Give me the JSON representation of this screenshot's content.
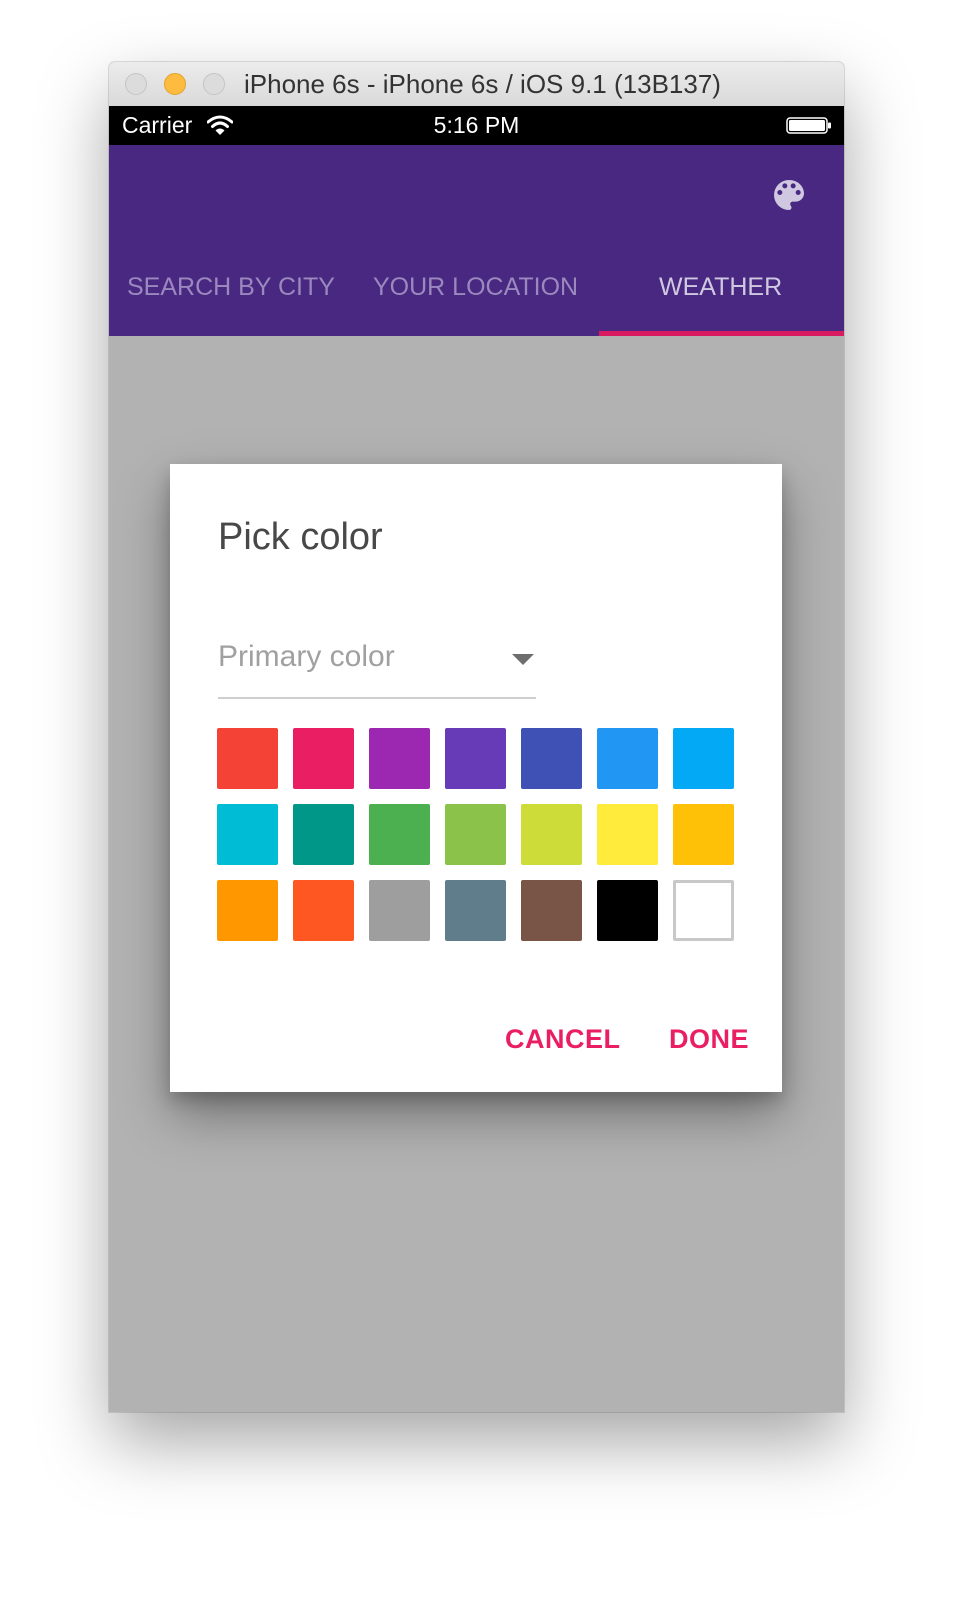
{
  "window": {
    "title": "iPhone 6s - iPhone 6s / iOS 9.1 (13B137)"
  },
  "status_bar": {
    "carrier": "Carrier",
    "time": "5:16 PM",
    "icons": [
      "wifi-icon",
      "battery-icon"
    ]
  },
  "app_bar": {
    "background": "#482880",
    "action_icon": "palette-icon",
    "tabs": [
      {
        "label": "SEARCH BY CITY",
        "selected": false
      },
      {
        "label": "YOUR LOCATION",
        "selected": false
      },
      {
        "label": "WEATHER",
        "selected": true
      }
    ],
    "indicator_color": "#d81b60"
  },
  "dialog": {
    "title": "Pick color",
    "select_value": "Primary color",
    "swatches": [
      "#f44336",
      "#e91e63",
      "#9c27b0",
      "#673ab7",
      "#3f51b5",
      "#2196f3",
      "#03a9f4",
      "#00bcd4",
      "#009688",
      "#4caf50",
      "#8bc34a",
      "#cddc39",
      "#ffeb3b",
      "#ffc107",
      "#ff9800",
      "#ff5722",
      "#9e9e9e",
      "#607d8b",
      "#795548",
      "#000000",
      "#ffffff"
    ],
    "cancel_label": "CANCEL",
    "done_label": "DONE",
    "accent": "#e91e63"
  }
}
